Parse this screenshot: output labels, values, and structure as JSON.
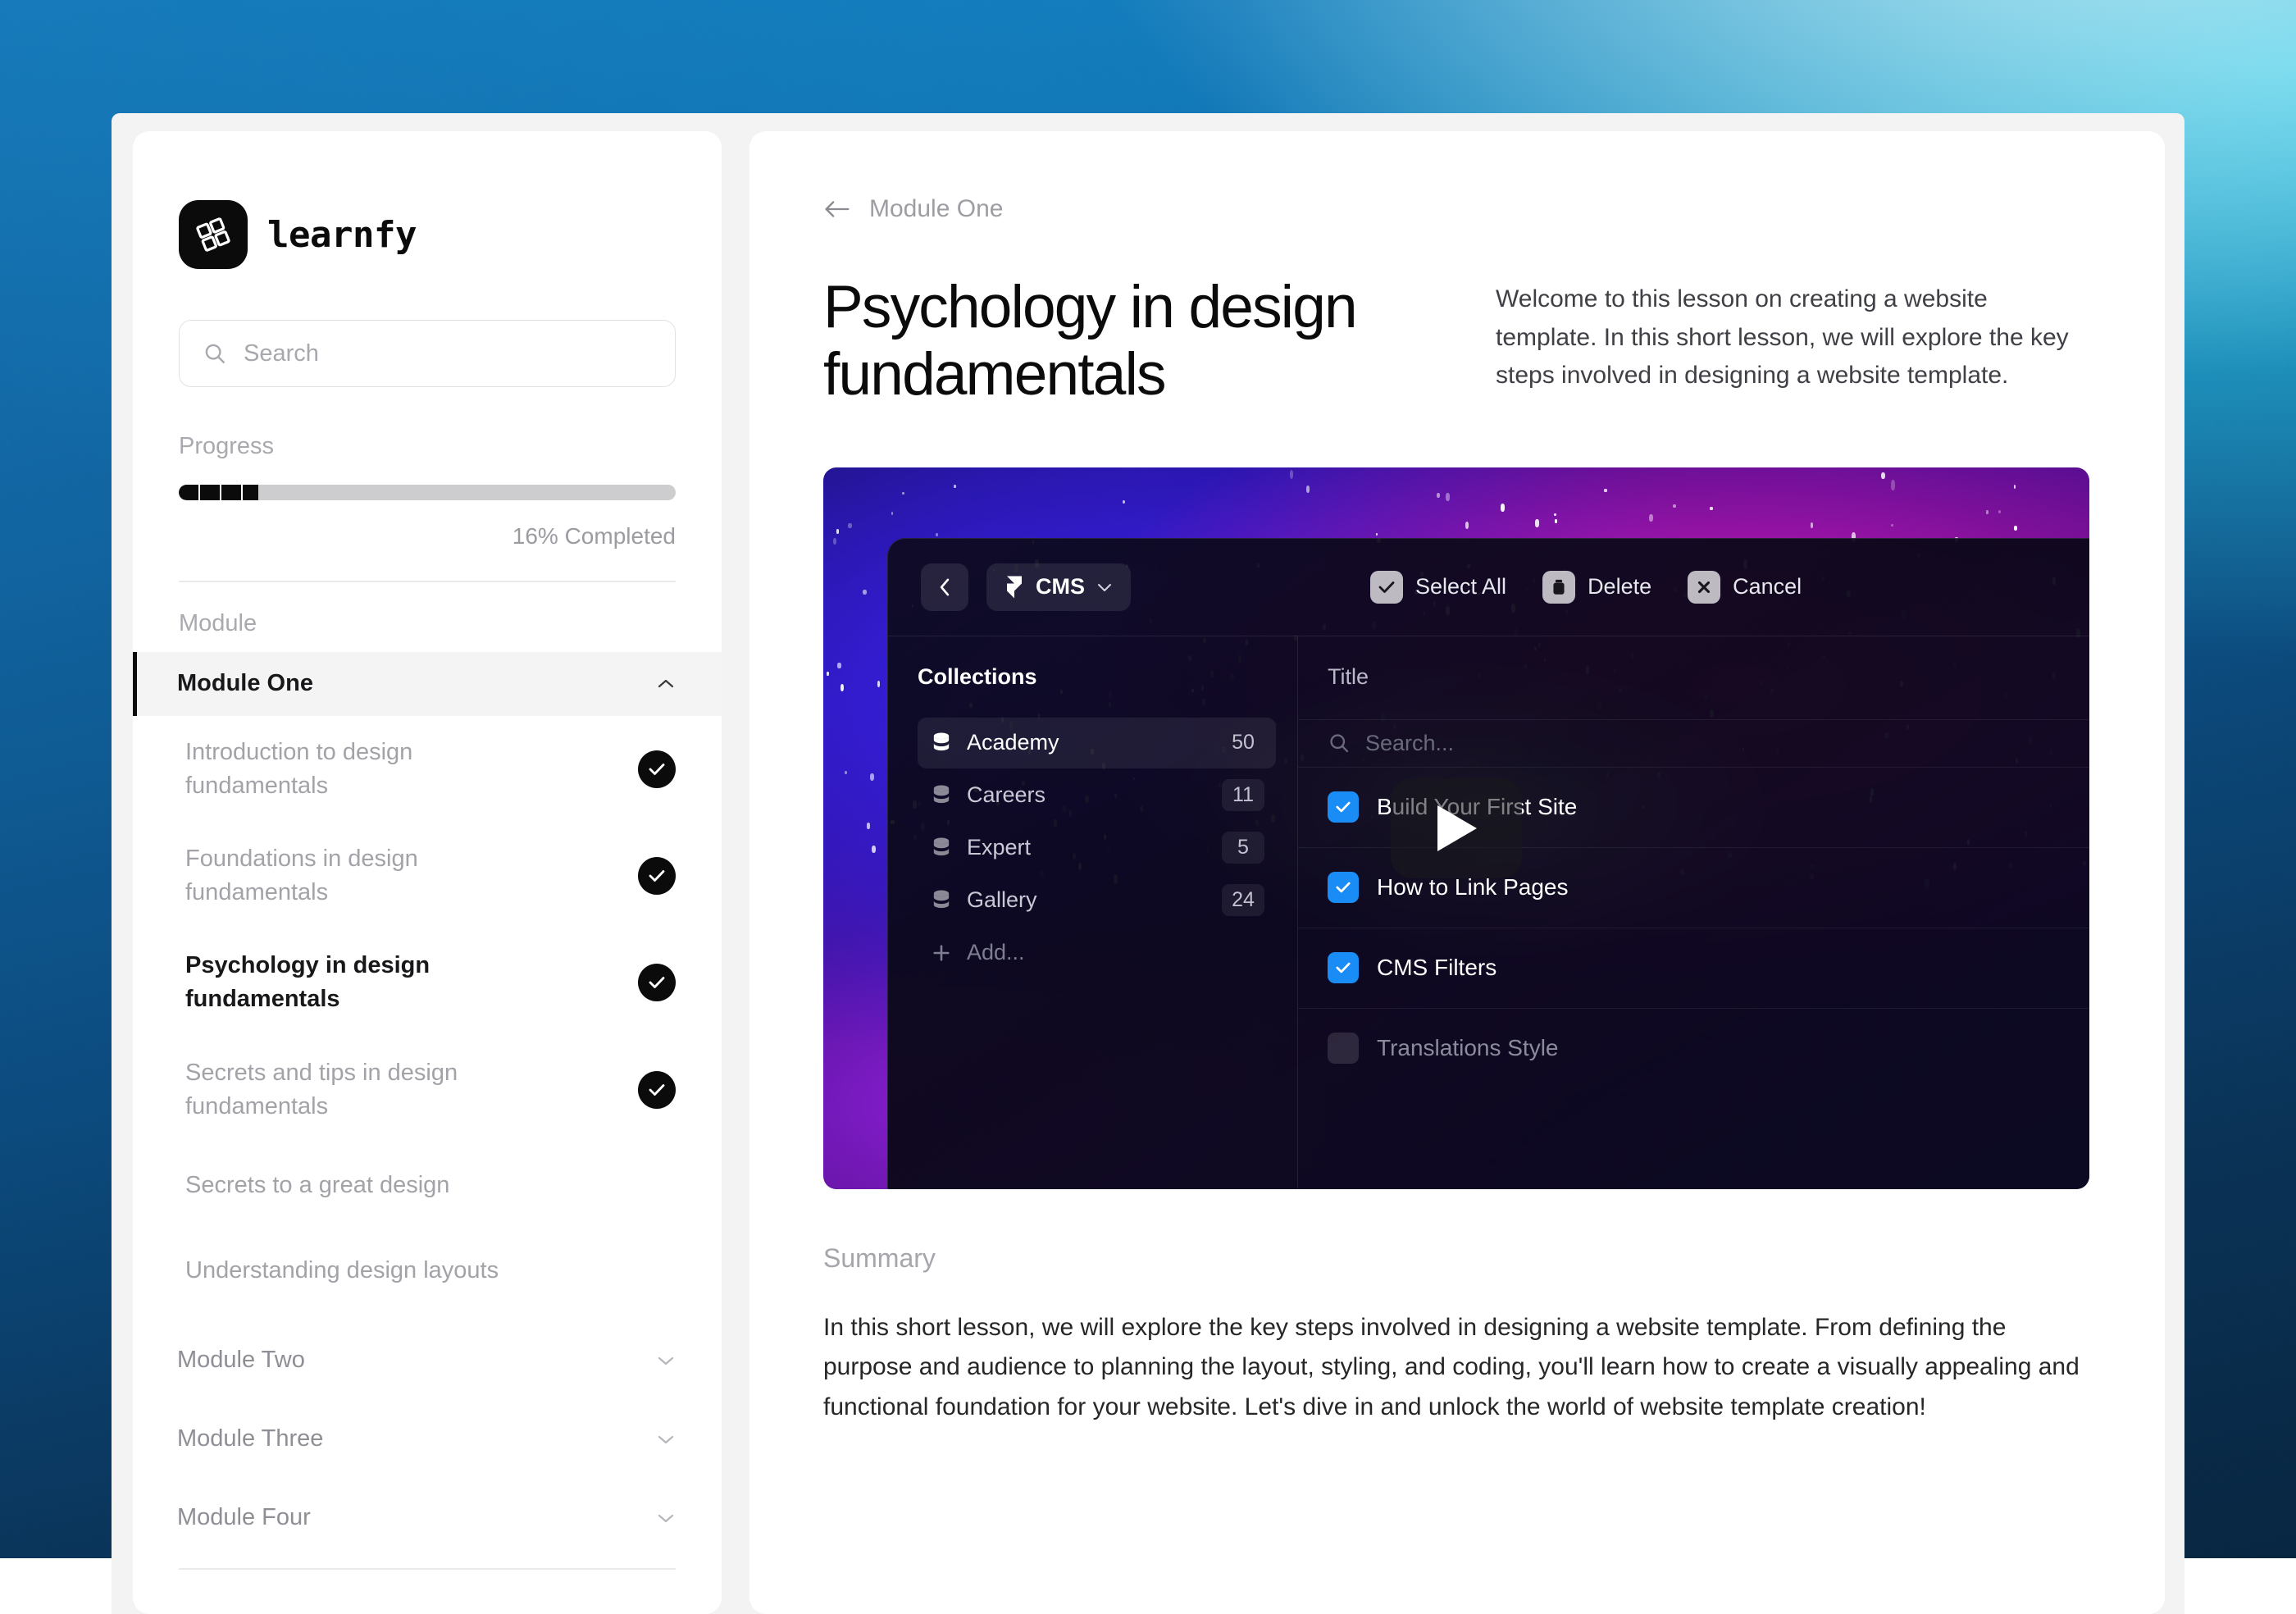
{
  "brand": {
    "name": "learnfy",
    "logo_icon": "learnfy-logo-icon"
  },
  "sidebar": {
    "search": {
      "placeholder": "Search",
      "icon": "search-icon"
    },
    "progress": {
      "label": "Progress",
      "percent": 16,
      "completed_text": "16% Completed"
    },
    "section_label": "Module",
    "modules": [
      {
        "label": "Module One",
        "expanded": true,
        "chevron": "chevron-up-icon",
        "lessons": [
          {
            "label": "Introduction to design fundamentals",
            "completed": true,
            "current": false
          },
          {
            "label": "Foundations in design fundamentals",
            "completed": true,
            "current": false
          },
          {
            "label": "Psychology in design fundamentals",
            "completed": true,
            "current": true
          },
          {
            "label": "Secrets and tips in design fundamentals",
            "completed": true,
            "current": false
          },
          {
            "label": "Secrets to a great design",
            "completed": false,
            "current": false
          },
          {
            "label": "Understanding design layouts",
            "completed": false,
            "current": false
          }
        ]
      },
      {
        "label": "Module Two",
        "expanded": false,
        "chevron": "chevron-down-icon",
        "lessons": []
      },
      {
        "label": "Module Three",
        "expanded": false,
        "chevron": "chevron-down-icon",
        "lessons": []
      },
      {
        "label": "Module Four",
        "expanded": false,
        "chevron": "chevron-down-icon",
        "lessons": []
      }
    ]
  },
  "main": {
    "breadcrumb": {
      "back_icon": "arrow-left-icon",
      "label": "Module One"
    },
    "title": "Psychology in design fundamentals",
    "intro": "Welcome to this lesson on creating a website template. In this short lesson, we will explore the key steps involved in designing a website template.",
    "video": {
      "play_icon": "play-icon",
      "cms": {
        "back_icon": "chevron-left-icon",
        "app_icon": "framer-icon",
        "app_name": "CMS",
        "app_chevron": "chevron-down-icon",
        "tools": [
          {
            "label": "Select All",
            "icon": "check-icon"
          },
          {
            "label": "Delete",
            "icon": "trash-icon"
          },
          {
            "label": "Cancel",
            "icon": "x-icon"
          }
        ],
        "collections_label": "Collections",
        "collections": [
          {
            "name": "Academy",
            "count": "50",
            "active": true,
            "chip": false
          },
          {
            "name": "Careers",
            "count": "11",
            "active": false,
            "chip": true
          },
          {
            "name": "Expert",
            "count": "5",
            "active": false,
            "chip": true
          },
          {
            "name": "Gallery",
            "count": "24",
            "active": false,
            "chip": true
          }
        ],
        "add_label": "Add...",
        "add_icon": "plus-icon",
        "title_column": "Title",
        "search_placeholder": "Search...",
        "search_icon": "search-icon",
        "rows": [
          {
            "title": "Build Your First Site",
            "checked": true
          },
          {
            "title": "How to Link Pages",
            "checked": true
          },
          {
            "title": "CMS Filters",
            "checked": true
          },
          {
            "title": "Translations Style",
            "checked": false
          }
        ]
      }
    },
    "summary_label": "Summary",
    "summary_body": "In this short lesson, we will explore the key steps involved in designing a website template. From defining the purpose and audience to planning the layout, styling, and coding, you'll learn how to create a visually appealing and functional foundation for your website. Let's dive in and unlock the world of website template creation!"
  },
  "colors": {
    "accent": "#0b0b0c",
    "checkbox_blue": "#1a8cf5",
    "muted": "#a9a9af",
    "shell": "#f3f3f4"
  }
}
